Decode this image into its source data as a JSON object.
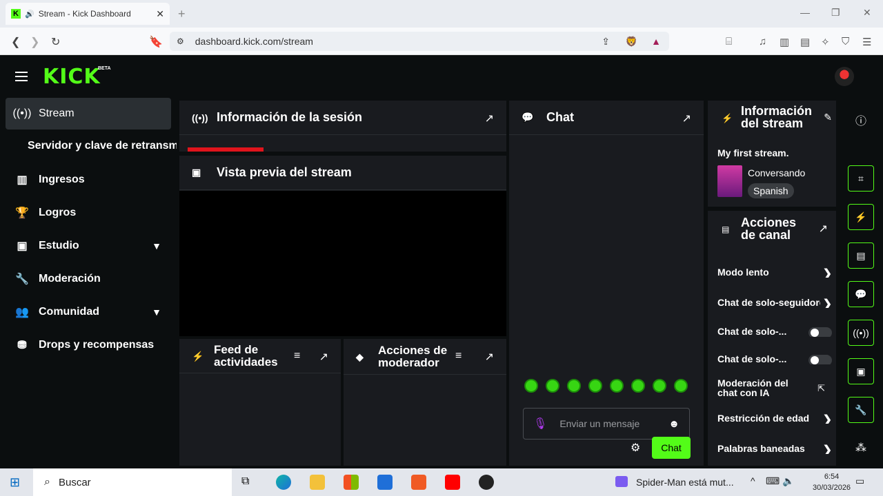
{
  "browser": {
    "tab_title": "Stream - Kick Dashboard",
    "url": "dashboard.kick.com/stream"
  },
  "header": {
    "logo": "KICK",
    "beta": "BETA"
  },
  "sidebar": {
    "items": [
      {
        "label": "Stream",
        "icon": "broadcast-icon"
      },
      {
        "label": "Servidor y clave de retransm",
        "icon": ""
      },
      {
        "label": "Ingresos",
        "icon": "chart-icon"
      },
      {
        "label": "Logros",
        "icon": "trophy-icon"
      },
      {
        "label": "Estudio",
        "icon": "studio-icon"
      },
      {
        "label": "Moderación",
        "icon": "wrench-icon"
      },
      {
        "label": "Comunidad",
        "icon": "people-icon"
      },
      {
        "label": "Drops y recompensas",
        "icon": "drops-icon"
      }
    ]
  },
  "panels": {
    "session_info": "Información de la sesión",
    "preview": "Vista previa del stream",
    "chat": "Chat",
    "feed": "Feed de actividades",
    "mod_actions": "Acciones de moderador"
  },
  "chat": {
    "placeholder": "Enviar un mensaje",
    "send_label": "Chat"
  },
  "stream_info": {
    "heading": "Información del stream",
    "title": "My first stream.",
    "category": "Conversando",
    "language": "Spanish"
  },
  "channel_actions": {
    "heading": "Acciones de canal",
    "rows": [
      {
        "label": "Modo lento",
        "control": "arrow"
      },
      {
        "label": "Chat de solo-seguidores",
        "control": "arrow"
      },
      {
        "label": "Chat de solo-...",
        "control": "toggle"
      },
      {
        "label": "Chat de solo-...",
        "control": "toggle"
      },
      {
        "label": "Moderación del chat con IA",
        "control": "external"
      },
      {
        "label": "Restricción de edad",
        "control": "arrow"
      },
      {
        "label": "Palabras baneadas",
        "control": "arrow"
      }
    ]
  },
  "taskbar": {
    "search": "Buscar",
    "notification": "Spider-Man está mut...",
    "time": "6:54",
    "date": "30/03/2026"
  },
  "colors": {
    "accent": "#53fc18",
    "panel": "#191b1f",
    "bg": "#0b0e0f"
  }
}
